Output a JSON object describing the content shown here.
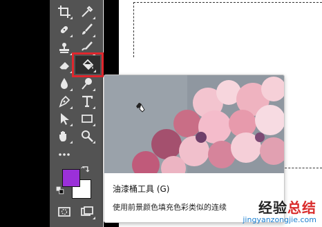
{
  "tooltip": {
    "title": "油漆桶工具 (G)",
    "description": "使用前景颜色填充色彩类似的连续"
  },
  "toolbar": {
    "foreground_color": "#9b30d9",
    "background_color": "#ffffff",
    "highlight_color": "#e0262d",
    "tools": [
      {
        "name": "crop-tool-icon"
      },
      {
        "name": "eyedropper-tool-icon"
      },
      {
        "name": "healing-brush-tool-icon"
      },
      {
        "name": "brush-tool-icon"
      },
      {
        "name": "clone-stamp-tool-icon"
      },
      {
        "name": "history-brush-tool-icon"
      },
      {
        "name": "eraser-tool-icon"
      },
      {
        "name": "paint-bucket-tool-icon"
      },
      {
        "name": "blur-tool-icon"
      },
      {
        "name": "dodge-tool-icon"
      },
      {
        "name": "pen-tool-icon"
      },
      {
        "name": "type-tool-icon"
      },
      {
        "name": "path-selection-tool-icon"
      },
      {
        "name": "rectangle-tool-icon"
      },
      {
        "name": "hand-tool-icon"
      },
      {
        "name": "zoom-tool-icon"
      },
      {
        "name": "more-tools-icon"
      }
    ]
  },
  "watermark": {
    "brand_a": "经验",
    "brand_b": "总结",
    "url": "jingyanzongjie.com"
  }
}
